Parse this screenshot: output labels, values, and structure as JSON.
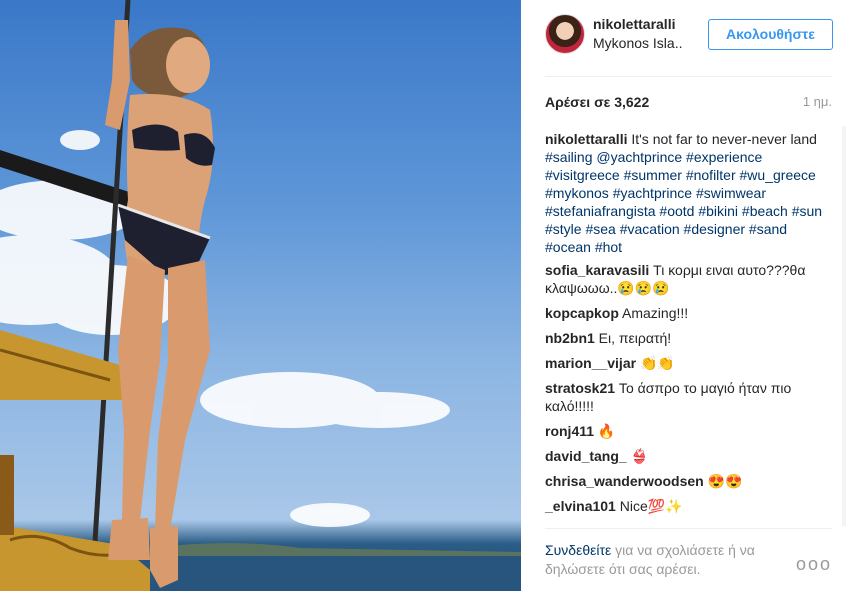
{
  "post": {
    "username": "nikolettaralli",
    "location": "Mykonos Isla..",
    "follow_label": "Ακολουθήστε",
    "likes": "Αρέσει σε 3,622",
    "time": "1 ημ."
  },
  "caption": {
    "user": "nikolettaralli",
    "text": " It's not far to never-never land ",
    "tags": "#sailing @yachtprince #experience #visitgreece #summer #nofilter #wu_greece #mykonos #yachtprince #swimwear #stefaniafrangista #ootd #bikini #beach #sun #style #sea #vacation #designer #sand #ocean #hot"
  },
  "comments": [
    {
      "user": "sofia_karavasili",
      "text": " Τι κορμι ειναι αυτο???θα κλαψωωω..😢😢😢"
    },
    {
      "user": "kopcapkop",
      "text": " Amazing!!!"
    },
    {
      "user": "nb2bn1",
      "text": " Ει, πειρατή!"
    },
    {
      "user": "marion__vijar",
      "text": " 👏👏"
    },
    {
      "user": "stratosk21",
      "text": " Το άσπρο το μαγιό ήταν πιο καλό!!!!!"
    },
    {
      "user": "ronj411",
      "text": " 🔥"
    },
    {
      "user": "david_tang_",
      "text": " 👙"
    },
    {
      "user": "chrisa_wanderwoodsen",
      "text": " 😍😍"
    },
    {
      "user": "_elvina101",
      "text": " Nice💯✨"
    }
  ],
  "footer": {
    "login_link": "Συνδεθείτε",
    "login_text": " για να σχολιάσετε ή να δηλώσετε ότι σας αρέσει.",
    "more": "ooo"
  },
  "colors": {
    "accent": "#3897f0",
    "link": "#003569",
    "muted": "#999999"
  }
}
